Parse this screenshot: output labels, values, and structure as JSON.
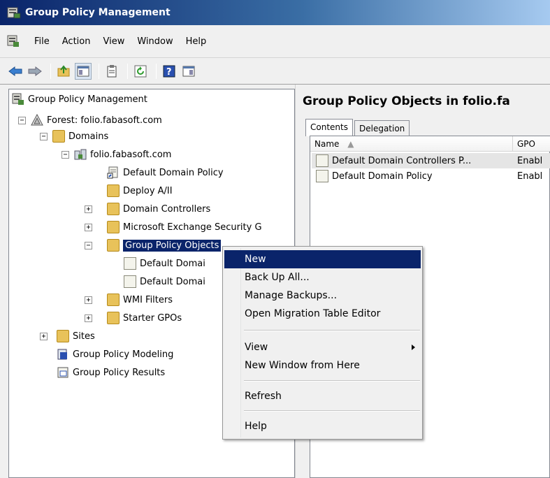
{
  "window": {
    "title": "Group Policy Management"
  },
  "menu": {
    "items": [
      "File",
      "Action",
      "View",
      "Window",
      "Help"
    ]
  },
  "toolbar": {
    "buttons": [
      "back-icon",
      "forward-icon",
      "up-folder-icon",
      "show-hide-tree-icon",
      "export-list-icon",
      "refresh-icon",
      "help-icon",
      "properties-icon"
    ]
  },
  "tree": {
    "root": "Group Policy Management",
    "forest": "Forest: folio.fabasoft.com",
    "domains": "Domains",
    "domain": "folio.fabasoft.com",
    "default_domain_policy": "Default Domain Policy",
    "deploy": "Deploy A/II",
    "domain_controllers": "Domain Controllers",
    "ms_exchange": "Microsoft Exchange Security G",
    "gpo": "Group Policy Objects",
    "gpo_child1": "Default Domai",
    "gpo_child2": "Default Domai",
    "wmi": "WMI Filters",
    "starter": "Starter GPOs",
    "sites": "Sites",
    "modeling": "Group Policy Modeling",
    "results": "Group Policy Results"
  },
  "right_pane": {
    "title": "Group Policy Objects in folio.fa",
    "tabs": [
      "Contents",
      "Delegation"
    ],
    "columns": [
      "Name",
      "GPO"
    ],
    "rows": [
      {
        "name": "Default Domain Controllers P...",
        "status": "Enabl"
      },
      {
        "name": "Default Domain Policy",
        "status": "Enabl"
      }
    ]
  },
  "context_menu": {
    "new": "New",
    "backup_all": "Back Up All...",
    "manage_backups": "Manage Backups...",
    "open_migration": "Open Migration Table Editor",
    "view": "View",
    "new_window": "New Window from Here",
    "refresh": "Refresh",
    "help": "Help"
  }
}
